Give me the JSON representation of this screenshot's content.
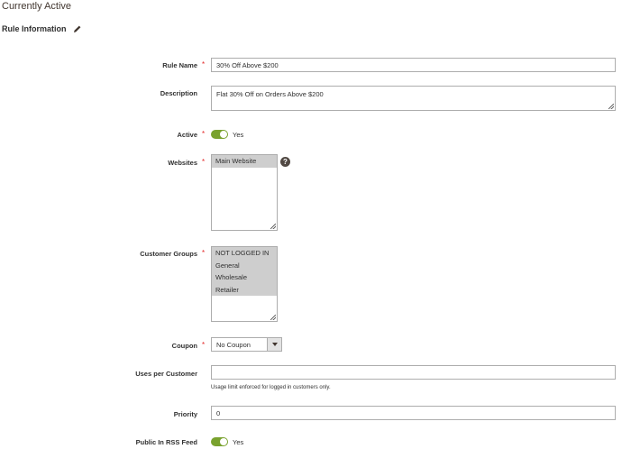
{
  "header": {
    "section_title": "Currently Active",
    "rule_info_title": "Rule Information"
  },
  "form": {
    "rule_name": {
      "label": "Rule Name",
      "value": "30% Off Above $200"
    },
    "description": {
      "label": "Description",
      "value": "Flat 30% Off on Orders Above $200"
    },
    "active": {
      "label": "Active",
      "state": "Yes"
    },
    "websites": {
      "label": "Websites",
      "options": [
        "Main Website"
      ]
    },
    "customer_groups": {
      "label": "Customer Groups",
      "options": [
        "NOT LOGGED IN",
        "General",
        "Wholesale",
        "Retailer"
      ]
    },
    "coupon": {
      "label": "Coupon",
      "value": "No Coupon"
    },
    "uses_per_customer": {
      "label": "Uses per Customer",
      "value": "",
      "note": "Usage limit enforced for logged in customers only."
    },
    "priority": {
      "label": "Priority",
      "value": "0"
    },
    "public_rss": {
      "label": "Public In RSS Feed",
      "state": "Yes"
    }
  },
  "required_marker": "*",
  "help_glyph": "?",
  "colors": {
    "toggle_on": "#79a22e",
    "required": "#e22626",
    "selected_option": "#cecece"
  }
}
